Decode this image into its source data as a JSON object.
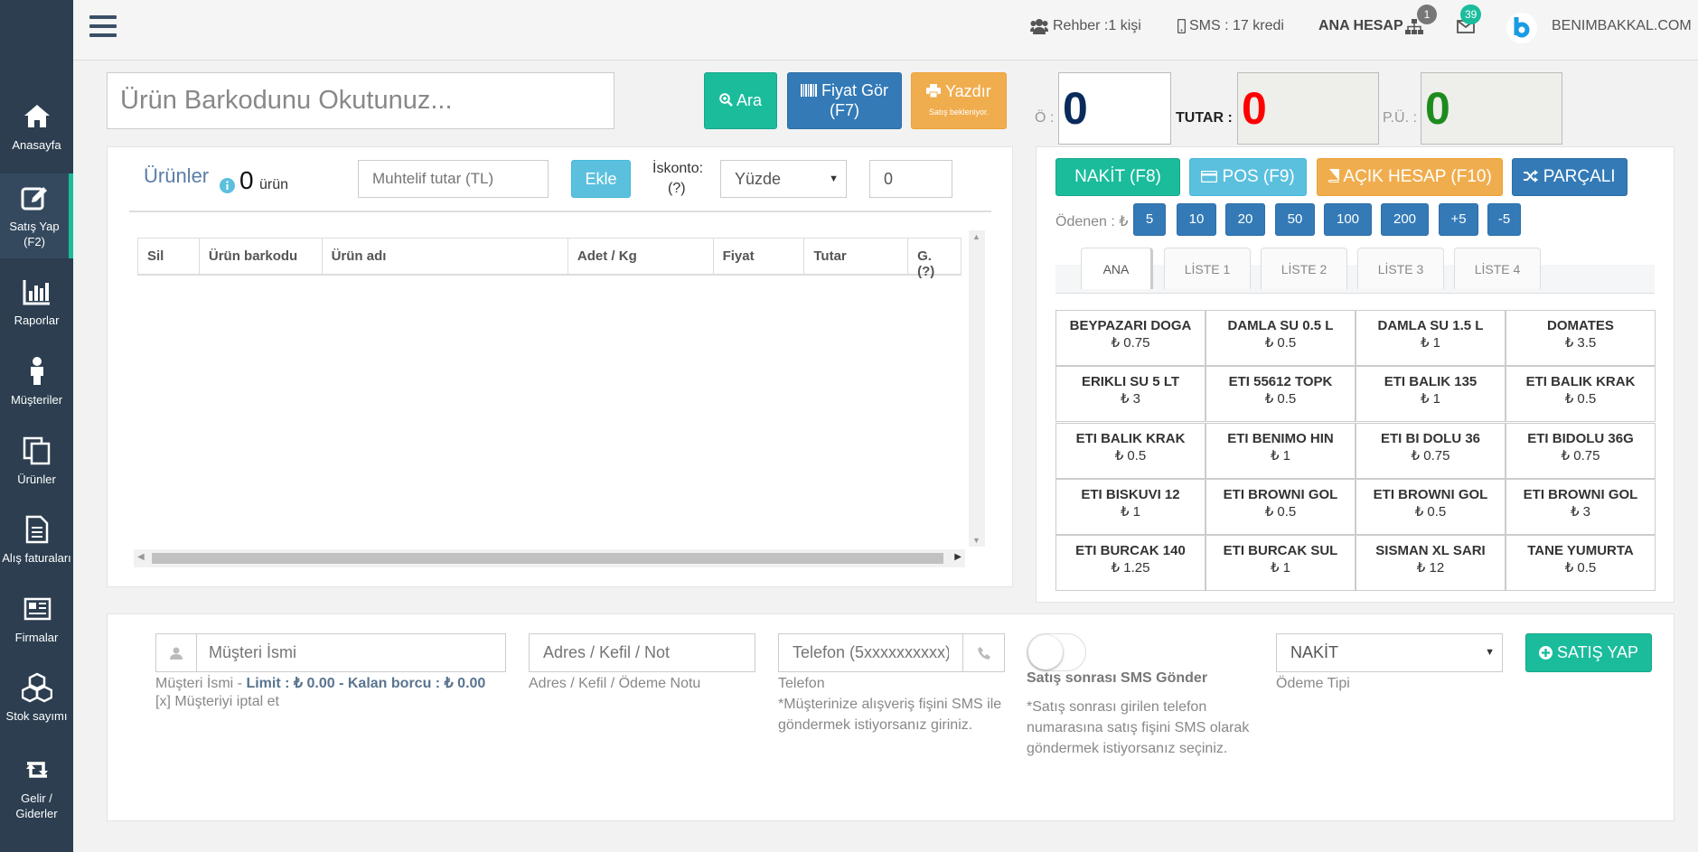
{
  "sidebar": {
    "items": [
      {
        "label": "Anasayfa",
        "icon": "home-icon"
      },
      {
        "label": "Satış Yap (F2)",
        "icon": "edit-icon"
      },
      {
        "label": "Raporlar",
        "icon": "bar-chart-icon"
      },
      {
        "label": "Müşteriler",
        "icon": "person-icon"
      },
      {
        "label": "Ürünler",
        "icon": "copy-icon"
      },
      {
        "label": "Alış faturaları",
        "icon": "document-icon"
      },
      {
        "label": "Firmalar",
        "icon": "newspaper-icon"
      },
      {
        "label": "Stok sayımı",
        "icon": "cubes-icon"
      },
      {
        "label": "Gelir / Giderler",
        "icon": "retweet-icon"
      }
    ]
  },
  "topbar": {
    "rehber": "Rehber :1 kişi",
    "sms": "SMS : 17 kredi",
    "account": "ANA HESAP",
    "account_badge": "1",
    "mail_badge": "39",
    "brand": "BENIMBAKKAL.COM"
  },
  "search": {
    "placeholder": "Ürün Barkodunu Okutunuz...",
    "ara_label": "Ara",
    "fiyat_label": "Fiyat Gör",
    "fiyat_sub": "(F7)",
    "yazdir_label": "Yazdır",
    "yazdir_sub": "Satış bekleniyor."
  },
  "totals": {
    "o_label": "Ö :",
    "o_value": "0",
    "tutar_label": "TUTAR :",
    "tutar_value": "0",
    "pu_label": "P.Ü. :",
    "pu_value": "0"
  },
  "products_panel": {
    "title": "Ürünler",
    "count": "0",
    "count_unit": "ürün",
    "muhtelif_placeholder": "Muhtelif tutar (TL)",
    "ekle_label": "Ekle",
    "iskonto_label": "İskonto:",
    "iskonto_help": "(?)",
    "iskonto_type": "Yüzde",
    "iskonto_value": "0",
    "columns": [
      "Sil",
      "Ürün barkodu",
      "Ürün adı",
      "Adet / Kg",
      "Fiyat",
      "Tutar",
      "G. (?)"
    ]
  },
  "payment": {
    "nakit": "NAKİT (F8)",
    "pos": "POS (F9)",
    "acik": "AÇIK HESAP (F10)",
    "parcali": "PARÇALI",
    "odenen_label": "Ödenen : ₺",
    "amounts": [
      "5",
      "10",
      "20",
      "50",
      "100",
      "200",
      "+5",
      "-5"
    ]
  },
  "tabs": [
    "ANA",
    "LİSTE 1",
    "LİSTE 2",
    "LİSTE 3",
    "LİSTE 4"
  ],
  "quick_products": [
    {
      "name": "BEYPAZARI DOGA",
      "price": "₺ 0.75"
    },
    {
      "name": "DAMLA SU 0.5 L",
      "price": "₺ 0.5"
    },
    {
      "name": "DAMLA SU 1.5 L",
      "price": "₺ 1"
    },
    {
      "name": "DOMATES",
      "price": "₺ 3.5"
    },
    {
      "name": "ERIKLI SU 5 LT",
      "price": "₺ 3"
    },
    {
      "name": "ETI 55612 TOPK",
      "price": "₺ 0.5"
    },
    {
      "name": "ETI BALIK 135",
      "price": "₺ 1"
    },
    {
      "name": "ETI BALIK KRAK",
      "price": "₺ 0.5"
    },
    {
      "name": "ETI BALIK KRAK",
      "price": "₺ 0.5"
    },
    {
      "name": "ETI BENIMO HIN",
      "price": "₺ 1"
    },
    {
      "name": "ETI BI DOLU 36",
      "price": "₺ 0.75"
    },
    {
      "name": "ETI BIDOLU 36G",
      "price": "₺ 0.75"
    },
    {
      "name": "ETI BISKUVI 12",
      "price": "₺ 1"
    },
    {
      "name": "ETI BROWNI GOL",
      "price": "₺ 0.5"
    },
    {
      "name": "ETI BROWNI GOL",
      "price": "₺ 0.5"
    },
    {
      "name": "ETI BROWNI GOL",
      "price": "₺ 3"
    },
    {
      "name": "ETI BURCAK 140",
      "price": "₺ 1.25"
    },
    {
      "name": "ETI BURCAK SUL",
      "price": "₺ 1"
    },
    {
      "name": "SISMAN XL SARI",
      "price": "₺ 12"
    },
    {
      "name": "TANE YUMURTA",
      "price": "₺ 0.5"
    }
  ],
  "customer": {
    "name_placeholder": "Müşteri İsmi",
    "name_help_prefix": "Müşteri İsmi - ",
    "limit_text": "Limit : ₺ 0.00",
    "balance_text": " - Kalan borcu : ₺ 0.00",
    "cancel": "[x] Müşteriyi iptal et",
    "address_placeholder": "Adres / Kefil / Not",
    "address_help": "Adres / Kefil / Ödeme Notu",
    "phone_placeholder": "Telefon (5xxxxxxxxxx)",
    "phone_label": "Telefon",
    "phone_note": "*Müşterinize alışveriş fişini SMS ile göndermek istiyorsanız giriniz.",
    "sms_label": "Satış sonrası SMS Gönder",
    "sms_note": "*Satış sonrası girilen telefon numarasına satış fişini SMS olarak göndermek istiyorsanız seçiniz.",
    "payment_type": "NAKİT",
    "payment_type_label": "Ödeme Tipi",
    "submit": "SATIŞ YAP"
  },
  "colors": {
    "sidebar": "#2c3e50",
    "green": "#1abc9c",
    "blue": "#337ab7",
    "orange": "#f0ad4e",
    "light_blue": "#5bc0de",
    "tutar_red": "#ff0000",
    "pu_green": "#1e8b1e",
    "o_navy": "#0b2a5c"
  }
}
